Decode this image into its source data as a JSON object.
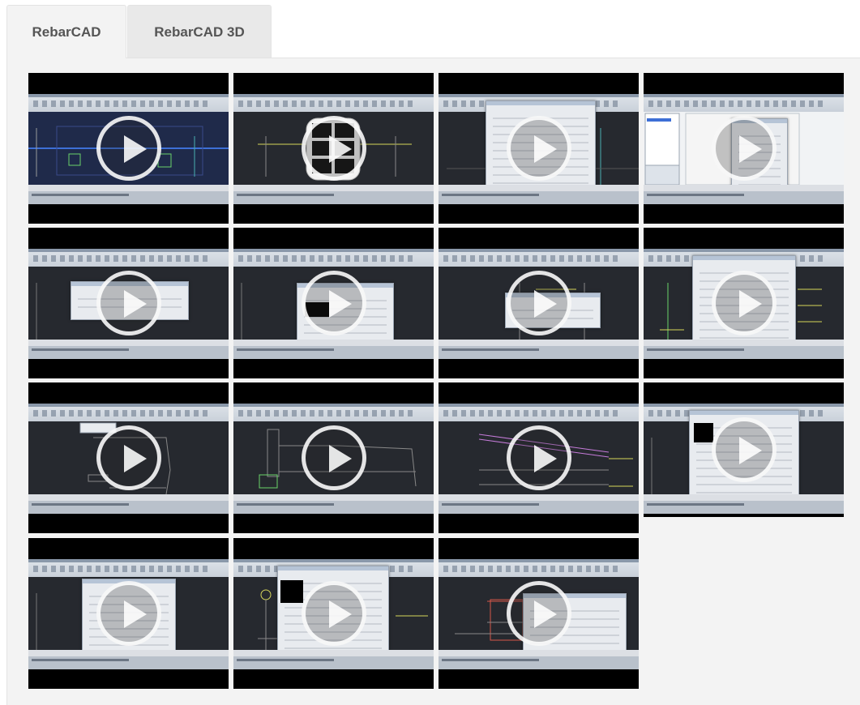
{
  "tabs": [
    {
      "label": "RebarCAD",
      "active": true
    },
    {
      "label": "RebarCAD 3D",
      "active": false
    }
  ],
  "videos": [
    {
      "row": 1,
      "col": 1
    },
    {
      "row": 1,
      "col": 2
    },
    {
      "row": 1,
      "col": 3
    },
    {
      "row": 1,
      "col": 4
    },
    {
      "row": 2,
      "col": 1
    },
    {
      "row": 2,
      "col": 2
    },
    {
      "row": 2,
      "col": 3
    },
    {
      "row": 2,
      "col": 4
    },
    {
      "row": 3,
      "col": 1
    },
    {
      "row": 3,
      "col": 2
    },
    {
      "row": 3,
      "col": 3
    },
    {
      "row": 3,
      "col": 4
    },
    {
      "row": 4,
      "col": 1
    },
    {
      "row": 4,
      "col": 2
    },
    {
      "row": 4,
      "col": 3
    }
  ],
  "icons": {
    "play": "play-button-icon"
  },
  "colors": {
    "tab_active_bg": "#f3f3f3",
    "tab_inactive_bg": "#e9e9e9",
    "panel_bg": "#f3f3f3",
    "tab_text": "#555555",
    "video_bg": "#000000",
    "cad_bg": "#26292f"
  }
}
